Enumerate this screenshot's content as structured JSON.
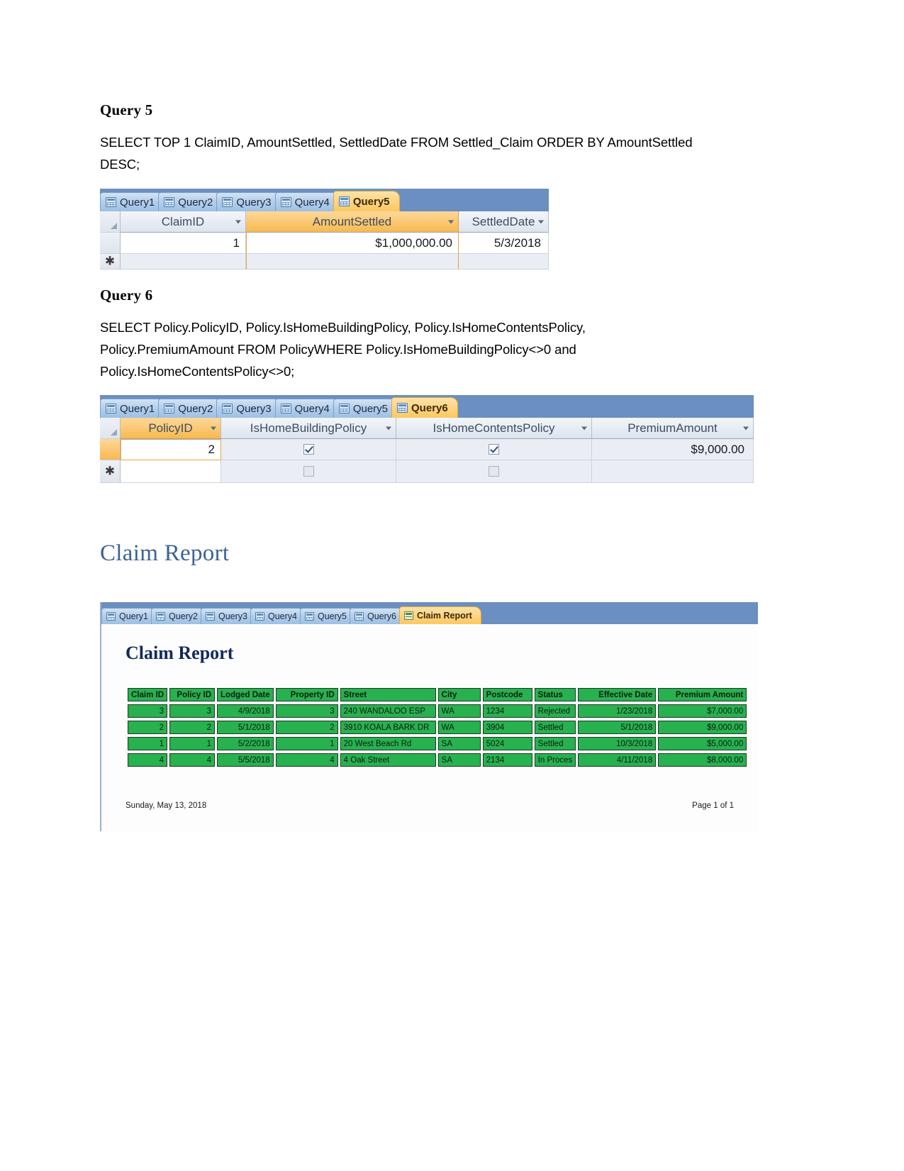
{
  "document": {
    "query5": {
      "heading": "Query 5",
      "sql": "SELECT TOP 1 ClaimID, AmountSettled, SettledDate FROM Settled_Claim ORDER BY AmountSettled DESC;"
    },
    "query6": {
      "heading": "Query 6",
      "sql": "SELECT Policy.PolicyID, Policy.IsHomeBuildingPolicy, Policy.IsHomeContentsPolicy, Policy.PremiumAmount FROM PolicyWHERE Policy.IsHomeBuildingPolicy<>0 and Policy.IsHomeContentsPolicy<>0;"
    },
    "report_section": {
      "heading": "Claim Report"
    }
  },
  "access_query5": {
    "tabs": [
      {
        "label": "Query1",
        "icon": "query-icon",
        "active": false
      },
      {
        "label": "Query2",
        "icon": "query-icon",
        "active": false
      },
      {
        "label": "Query3",
        "icon": "query-icon",
        "active": false
      },
      {
        "label": "Query4",
        "icon": "query-icon",
        "active": false
      },
      {
        "label": "Query5",
        "icon": "query-icon",
        "active": true
      }
    ],
    "columns": [
      {
        "label": "ClaimID",
        "sorted": false
      },
      {
        "label": "AmountSettled",
        "sorted": true
      },
      {
        "label": "SettledDate",
        "sorted": false
      }
    ],
    "rows": [
      {
        "ClaimID": "1",
        "AmountSettled": "$1,000,000.00",
        "SettledDate": "5/3/2018"
      }
    ],
    "new_record_marker": "✱"
  },
  "access_query6": {
    "tabs": [
      {
        "label": "Query1",
        "icon": "query-icon",
        "active": false
      },
      {
        "label": "Query2",
        "icon": "query-icon",
        "active": false
      },
      {
        "label": "Query3",
        "icon": "query-icon",
        "active": false
      },
      {
        "label": "Query4",
        "icon": "query-icon",
        "active": false
      },
      {
        "label": "Query5",
        "icon": "query-icon",
        "active": false
      },
      {
        "label": "Query6",
        "icon": "query-icon",
        "active": true
      }
    ],
    "columns": [
      {
        "label": "PolicyID",
        "highlighted": true
      },
      {
        "label": "IsHomeBuildingPolicy",
        "highlighted": false
      },
      {
        "label": "IsHomeContentsPolicy",
        "highlighted": false
      },
      {
        "label": "PremiumAmount",
        "highlighted": false
      }
    ],
    "rows": [
      {
        "PolicyID": "2",
        "IsHomeBuildingPolicy": true,
        "IsHomeContentsPolicy": true,
        "PremiumAmount": "$9,000.00"
      }
    ],
    "new_record_marker": "✱"
  },
  "access_report": {
    "tabs": [
      {
        "label": "Query1",
        "icon": "query-icon",
        "active": false
      },
      {
        "label": "Query2",
        "icon": "query-icon",
        "active": false
      },
      {
        "label": "Query3",
        "icon": "query-icon",
        "active": false
      },
      {
        "label": "Query4",
        "icon": "query-icon",
        "active": false
      },
      {
        "label": "Query5",
        "icon": "query-icon",
        "active": false
      },
      {
        "label": "Query6",
        "icon": "query-icon",
        "active": false
      },
      {
        "label": "Claim Report",
        "icon": "report-icon",
        "active": true
      }
    ],
    "title": "Claim Report",
    "columns": [
      "Claim ID",
      "Policy ID",
      "Lodged Date",
      "Property ID",
      "Street",
      "City",
      "Postcode",
      "Status",
      "Effective Date",
      "Premium Amount"
    ],
    "rows": [
      {
        "claim_id": "3",
        "policy_id": "3",
        "lodged_date": "4/9/2018",
        "property_id": "3",
        "street": "240 WANDALOO ESP",
        "city": "WA",
        "postcode": "1234",
        "status": "Rejected",
        "effective_date": "1/23/2018",
        "premium_amount": "$7,000.00"
      },
      {
        "claim_id": "2",
        "policy_id": "2",
        "lodged_date": "5/1/2018",
        "property_id": "2",
        "street": "3910 KOALA BARK DR",
        "city": "WA",
        "postcode": "3904",
        "status": "Settled",
        "effective_date": "5/1/2018",
        "premium_amount": "$9,000.00"
      },
      {
        "claim_id": "1",
        "policy_id": "1",
        "lodged_date": "5/2/2018",
        "property_id": "1",
        "street": "20 West Beach Rd",
        "city": "SA",
        "postcode": "5024",
        "status": "Settled",
        "effective_date": "10/3/2018",
        "premium_amount": "$5,000.00"
      },
      {
        "claim_id": "4",
        "policy_id": "4",
        "lodged_date": "5/5/2018",
        "property_id": "4",
        "street": "4 Oak Street",
        "city": "SA",
        "postcode": "2134",
        "status": "In Proces",
        "effective_date": "4/11/2018",
        "premium_amount": "$8,000.00"
      }
    ],
    "footer": {
      "date": "Sunday, May 13, 2018",
      "page": "Page 1 of 1"
    }
  },
  "colors": {
    "tab_active": "#fcc95f",
    "tab_bar": "#6a8fc0",
    "report_green": "#27b14f",
    "heading_blue": "#3d6395",
    "report_title_navy": "#12295c"
  }
}
